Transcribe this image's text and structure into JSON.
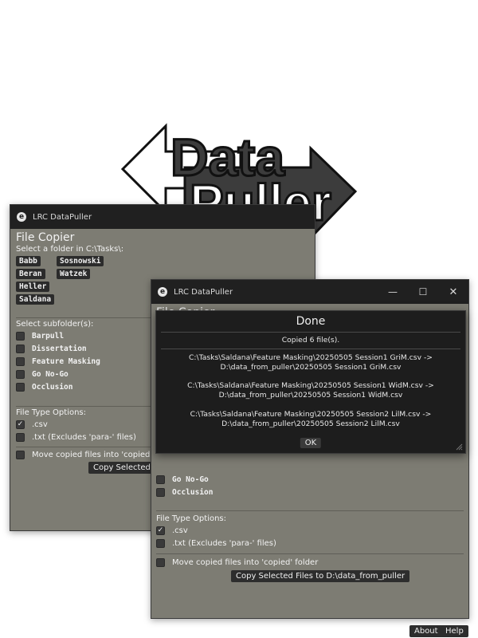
{
  "logo": {
    "line1": "Data",
    "line2": "Puller"
  },
  "back_window": {
    "title": "LRC DataPuller",
    "heading": "File Copier",
    "select_prompt": "Select a folder in C:\\Tasks\\:",
    "folders": [
      "Babb",
      "Sosnowski",
      "Beran",
      "Watzek",
      "Heller",
      "Saldana"
    ],
    "subfolder_label": "Select subfolder(s):",
    "subfolders": [
      "Barpull",
      "Dissertation",
      "Feature Masking",
      "Go No-Go",
      "Occlusion"
    ],
    "file_type_label": "File Type Options:",
    "csv_label": ".csv",
    "txt_label": ".txt (Excludes 'para-' files)",
    "move_label": "Move copied files into 'copied' folder",
    "copy_button": "Copy Selected File"
  },
  "front_window": {
    "title": "LRC DataPuller",
    "heading": "File Copier",
    "visible_subfolders": [
      "Go No-Go",
      "Occlusion"
    ],
    "file_type_label": "File Type Options:",
    "csv_label": ".csv",
    "txt_label": ".txt (Excludes 'para-' files)",
    "move_label": "Move copied files into 'copied' folder",
    "copy_button": "Copy Selected Files to D:\\data_from_puller",
    "about_button": "About",
    "help_button": "Help",
    "controls": {
      "minimize": "—",
      "maximize": "☐",
      "close": "✕"
    }
  },
  "dialog": {
    "title": "Done",
    "summary": "Copied 6 file(s).",
    "entries": [
      {
        "src": "C:\\Tasks\\Saldana\\Feature Masking\\20250505 Session1 GriM.csv ->",
        "dst": "D:\\data_from_puller\\20250505 Session1 GriM.csv"
      },
      {
        "src": "C:\\Tasks\\Saldana\\Feature Masking\\20250505 Session1 WidM.csv ->",
        "dst": "D:\\data_from_puller\\20250505 Session1 WidM.csv"
      },
      {
        "src": "C:\\Tasks\\Saldana\\Feature Masking\\20250505 Session2 LilM.csv ->",
        "dst": "D:\\data_from_puller\\20250505 Session2 LilM.csv"
      }
    ],
    "ok_button": "OK"
  }
}
